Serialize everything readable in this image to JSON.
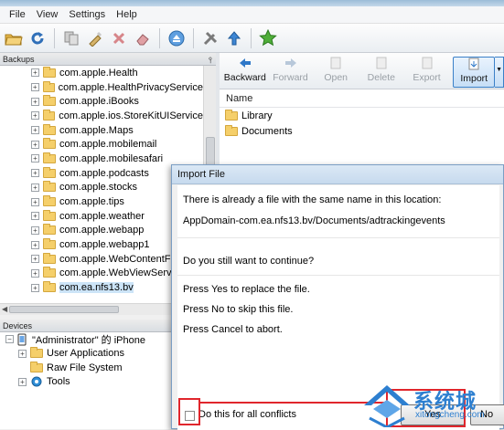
{
  "menu": [
    "File",
    "View",
    "Settings",
    "Help"
  ],
  "backups": {
    "header": "Backups",
    "items": [
      "com.apple.Health",
      "com.apple.HealthPrivacyService",
      "com.apple.iBooks",
      "com.apple.ios.StoreKitUIService",
      "com.apple.Maps",
      "com.apple.mobilemail",
      "com.apple.mobilesafari",
      "com.apple.podcasts",
      "com.apple.stocks",
      "com.apple.tips",
      "com.apple.weather",
      "com.apple.webapp",
      "com.apple.webapp1",
      "com.apple.WebContentFilte",
      "com.apple.WebViewService",
      "com.ea.nfs13.bv"
    ],
    "selected_index": 15
  },
  "devices": {
    "header": "Devices",
    "device_name": "\"Administrator\" 的 iPhone",
    "children": [
      "User Applications",
      "Raw File System",
      "Tools"
    ]
  },
  "file_toolbar": {
    "backward": "Backward",
    "forward": "Forward",
    "open": "Open",
    "delete": "Delete",
    "export": "Export",
    "import": "Import"
  },
  "file_list": {
    "column_name": "Name",
    "items": [
      "Library",
      "Documents"
    ]
  },
  "dialog": {
    "title": "Import File",
    "line1": "There is already a file with the same name in this location:",
    "path": "AppDomain-com.ea.nfs13.bv/Documents/adtrackingevents",
    "question": "Do you still want to continue?",
    "opt_yes": "Press Yes to replace the file.",
    "opt_no": "Press No to skip this file.",
    "opt_cancel": "Press Cancel to abort.",
    "checkbox_label": "Do this for all conflicts",
    "yes_label": "Yes",
    "no_label": "No"
  },
  "watermark": {
    "text": "系统城",
    "url": "xitongcheng.com"
  },
  "colors": {
    "accent": "#3a80c8",
    "highlight": "#e0262c",
    "watermark": "#2d7fd0"
  }
}
